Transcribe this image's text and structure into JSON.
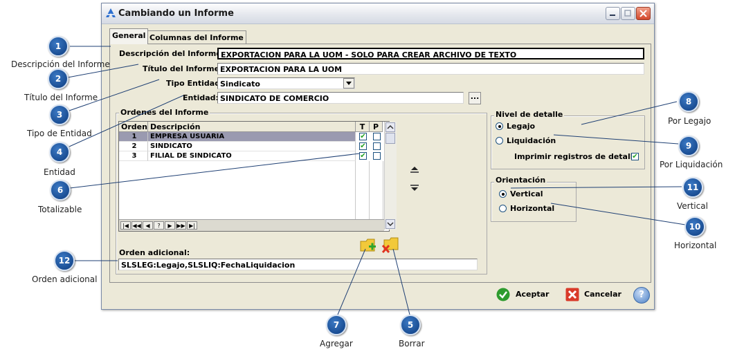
{
  "window": {
    "title": "Cambiando un Informe"
  },
  "tabs": [
    "General",
    "Columnas del Informe"
  ],
  "form": {
    "descripcion_label": "Descripción del Informe:",
    "descripcion_value": "EXPORTACION PARA LA UOM - SOLO PARA CREAR ARCHIVO DE TEXTO",
    "titulo_label": "Título del Informe:",
    "titulo_value": "EXPORTACION PARA LA UOM",
    "tipo_label": "Tipo Entidad:",
    "tipo_value": "Sindicato",
    "entidad_label": "Entidad:",
    "entidad_value": "SINDICATO DE COMERCIO",
    "entidad_btn": "..."
  },
  "ordenes": {
    "title": "Ordenes del Informe",
    "headers": [
      "Orden",
      "Descripción",
      "T",
      "P"
    ],
    "rows": [
      {
        "orden": "1",
        "descripcion": "EMPRESA USUARIA",
        "t": true,
        "p": false
      },
      {
        "orden": "2",
        "descripcion": "SINDICATO",
        "t": true,
        "p": false
      },
      {
        "orden": "3",
        "descripcion": "FILIAL DE SINDICATO",
        "t": true,
        "p": false
      }
    ],
    "nav": [
      "|◀",
      "◀◀",
      "◀",
      "?",
      "▶",
      "▶▶",
      "▶|"
    ]
  },
  "orden_adicional": {
    "label": "Orden adicional:",
    "value": "SLSLEG:Legajo,SLSLIQ:FechaLiquidacion"
  },
  "nivel": {
    "title": "Nivel de detalle",
    "legajo": "Legajo",
    "liquidacion": "Liquidación",
    "imprimir": "Imprimir registros de detalle"
  },
  "orientacion": {
    "title": "Orientación",
    "vertical": "Vertical",
    "horizontal": "Horizontal"
  },
  "buttons": {
    "aceptar": "Aceptar",
    "cancelar": "Cancelar",
    "help": "?"
  },
  "callouts": [
    {
      "n": "1",
      "text": "Descripción del Informe"
    },
    {
      "n": "2",
      "text": "Título del Informe"
    },
    {
      "n": "3",
      "text": "Tipo de Entidad"
    },
    {
      "n": "4",
      "text": "Entidad"
    },
    {
      "n": "6",
      "text": "Totalizable"
    },
    {
      "n": "12",
      "text": "Orden adicional"
    },
    {
      "n": "7",
      "text": "Agregar"
    },
    {
      "n": "5",
      "text": "Borrar"
    },
    {
      "n": "8",
      "text": "Por Legajo"
    },
    {
      "n": "9",
      "text": "Por Liquidación"
    },
    {
      "n": "11",
      "text": "Vertical"
    },
    {
      "n": "10",
      "text": "Horizontal"
    }
  ],
  "colors": {
    "badge": "#1a4f9c",
    "accent_green": "#2e9b2e",
    "cancel_red": "#d93a2a"
  }
}
